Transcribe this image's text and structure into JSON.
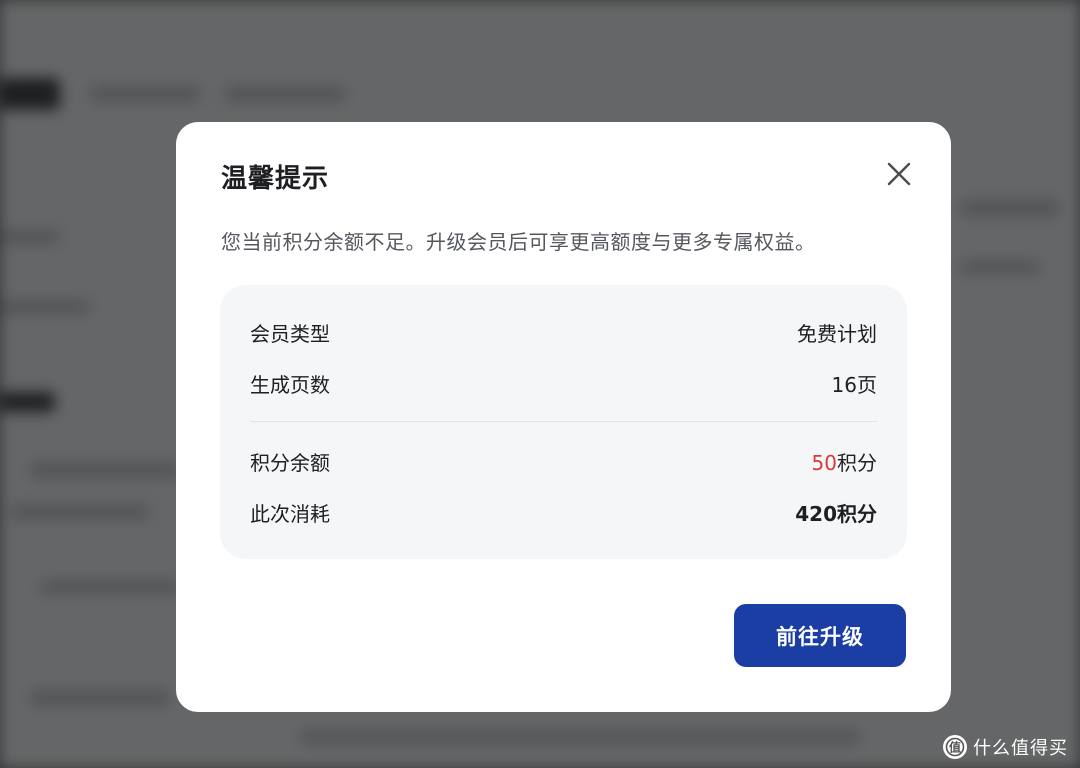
{
  "modal": {
    "title": "温馨提示",
    "message": "您当前积分余额不足。升级会员后可享更高额度与更多专属权益。",
    "rows": [
      {
        "label": "会员类型",
        "value": "免费计划"
      },
      {
        "label": "生成页数",
        "value": "16页"
      },
      {
        "label": "积分余额",
        "value_number": "50",
        "value_unit": "积分"
      },
      {
        "label": "此次消耗",
        "value": "420积分"
      }
    ],
    "upgrade_label": "前往升级"
  },
  "colors": {
    "primary_button": "#1b3ea4",
    "balance_highlight": "#d93a3a"
  },
  "icons": {
    "close": "close-icon",
    "watermark": "smzdm-logo-icon"
  },
  "watermark": {
    "text": "什么值得买"
  }
}
